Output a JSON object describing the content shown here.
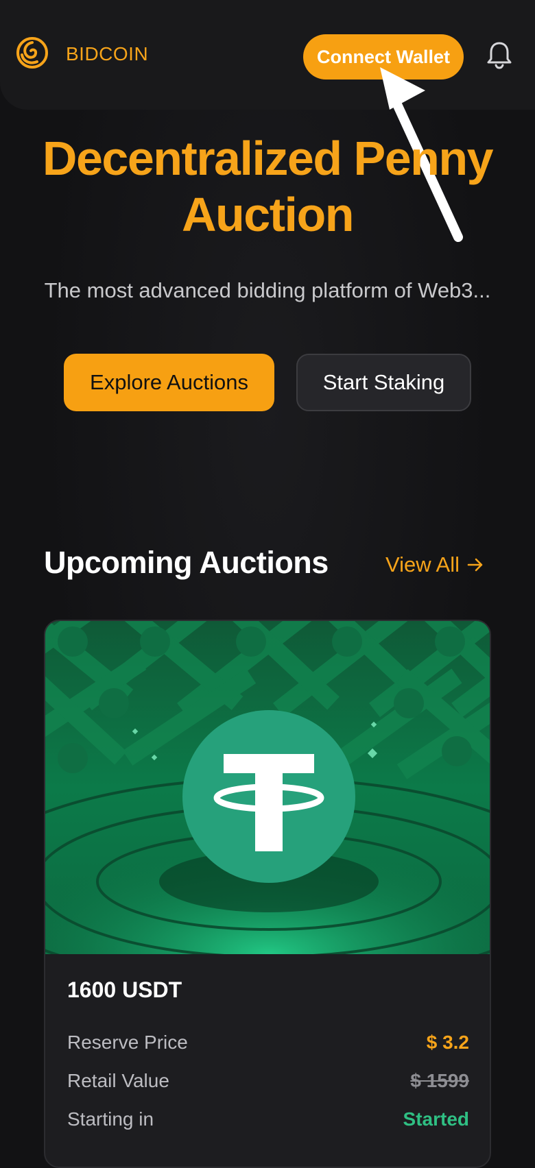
{
  "header": {
    "brand": "BIDCOIN",
    "connect_label": "Connect Wallet"
  },
  "hero": {
    "title_line1": "Decentralized Penny",
    "title_line2": "Auction",
    "subtitle": "The most advanced bidding platform of Web3...",
    "explore_label": "Explore Auctions",
    "stake_label": "Start Staking"
  },
  "section": {
    "title": "Upcoming Auctions",
    "view_all": "View All"
  },
  "auction_card": {
    "title": "1600 USDT",
    "rows": [
      {
        "label": "Reserve Price",
        "value": "$ 3.2"
      },
      {
        "label": "Retail Value",
        "value": "$ 1599"
      },
      {
        "label": "Starting in",
        "value": "Started"
      }
    ]
  },
  "icons": {
    "logo": "bidcoin-logo-icon",
    "bell": "bell-icon",
    "arrow": "arrow-right-icon",
    "token": "tether-icon"
  },
  "colors": {
    "accent": "#f7a012",
    "background": "#121214",
    "success": "#2fbf83",
    "tether": "#26a17b"
  }
}
